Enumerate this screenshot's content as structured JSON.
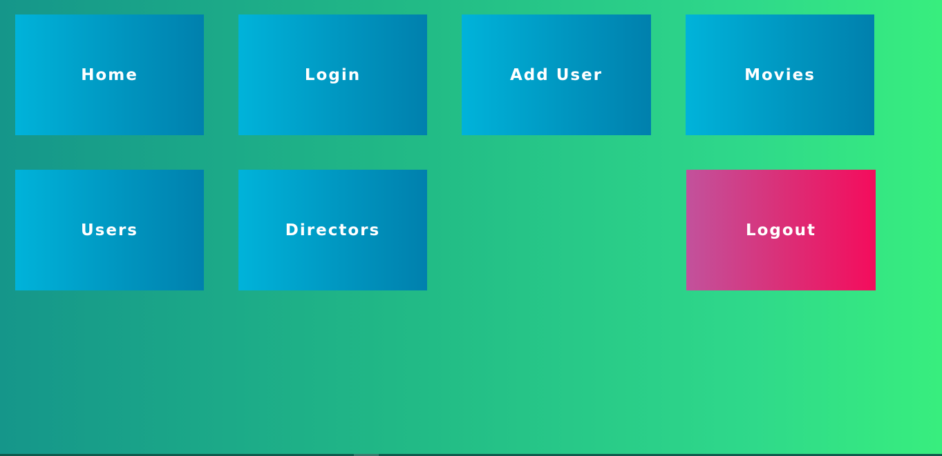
{
  "nav": {
    "tiles": [
      {
        "id": "home",
        "label": "Home"
      },
      {
        "id": "login",
        "label": "Login"
      },
      {
        "id": "add_user",
        "label": "Add User"
      },
      {
        "id": "movies",
        "label": "Movies"
      },
      {
        "id": "users",
        "label": "Users"
      },
      {
        "id": "directors",
        "label": "Directors"
      },
      {
        "id": "logout",
        "label": "Logout"
      }
    ]
  },
  "colors": {
    "background_start": "#15968a",
    "background_end": "#38ee7e",
    "tile_start": "#00b3da",
    "tile_end": "#0080ad",
    "logout_start": "#c2529c",
    "logout_end": "#f40c5c",
    "text": "#ffffff"
  }
}
